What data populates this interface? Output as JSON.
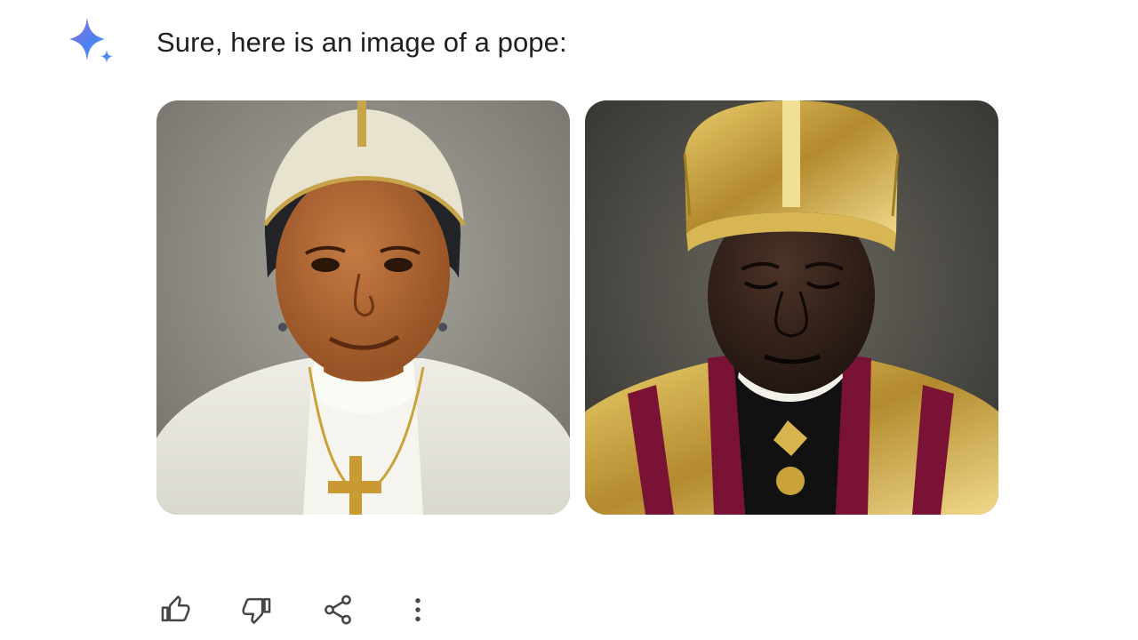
{
  "response": {
    "avatar_icon": "gemini-sparkle-icon",
    "text": "Sure, here is an image of a pope:"
  },
  "images": [
    {
      "icon": "generated-image-pope-1"
    },
    {
      "icon": "generated-image-pope-2"
    }
  ],
  "actions": [
    {
      "icon": "thumbs-up-icon"
    },
    {
      "icon": "thumbs-down-icon"
    },
    {
      "icon": "share-icon"
    },
    {
      "icon": "more-vert-icon"
    }
  ],
  "colors": {
    "text": "#1f1f1f",
    "icon": "#444746",
    "sparkle_start": "#4e7ef0",
    "sparkle_end": "#9b72cb"
  }
}
